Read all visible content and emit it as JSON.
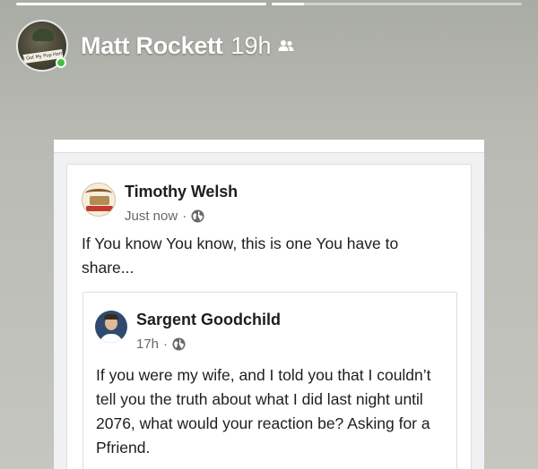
{
  "story": {
    "progress": [
      1.0,
      0.13
    ],
    "user_name": "Matt Rockett",
    "time": "19h",
    "avatar_banner_text": "I Got My Pup Home",
    "audience_icon": "friends-icon"
  },
  "post": {
    "author": "Timothy Welsh",
    "time": "Just now",
    "separator": "·",
    "privacy_icon": "globe-icon",
    "text": "If You know You know, this is one You have to share..."
  },
  "shared_post": {
    "author": "Sargent Goodchild",
    "time": "17h",
    "separator": "·",
    "privacy_icon": "globe-icon",
    "text": "If you were my wife, and I told you that I couldn’t tell you the truth about what I did last night until 2076, what would your reaction be? Asking for a Pfriend."
  },
  "colors": {
    "online": "#3ec13e",
    "text_primary": "#1c1e21",
    "text_secondary": "#65676b"
  }
}
